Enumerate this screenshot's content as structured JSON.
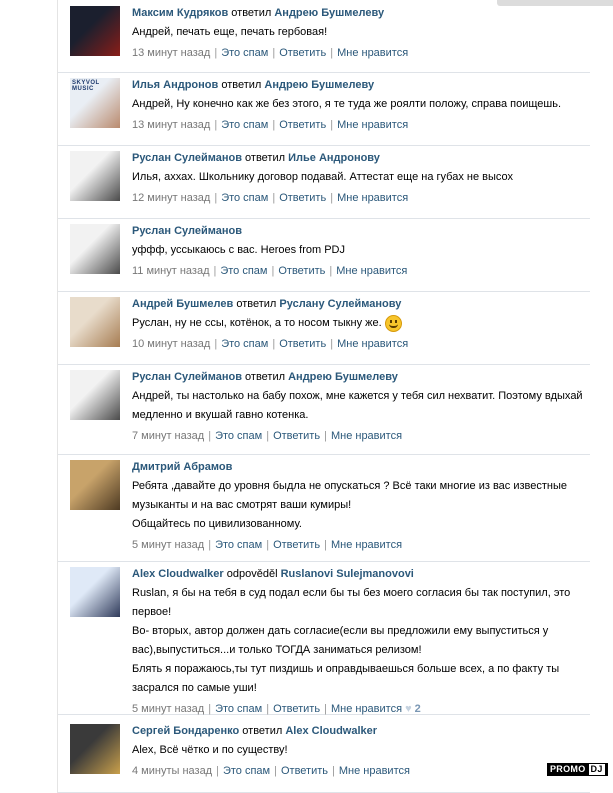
{
  "comments": [
    {
      "author": "Максим Кудряков",
      "verb": "ответил",
      "target": "Андрею Бушмелеву",
      "lines": [
        "Андрей, печать еще, печать гербовая!"
      ],
      "time": "13 минут назад",
      "spam": "Это спам",
      "reply": "Ответить",
      "like": "Мне нравится",
      "avatar_colors": [
        "#1b1f2e",
        "#8a1e18"
      ]
    },
    {
      "author": "Илья Андронов",
      "verb": "ответил",
      "target": "Андрею Бушмелеву",
      "lines": [
        "Андрей, Ну конечно как же без этого, я те туда же роялти положу, справа поищешь."
      ],
      "time": "13 минут назад",
      "spam": "Это спам",
      "reply": "Ответить",
      "like": "Мне нравится",
      "avatar_text": "SKYVOL MUSIC",
      "avatar_colors": [
        "#e9eef4",
        "#b98a6e"
      ]
    },
    {
      "author": "Руслан Сулейманов",
      "verb": "ответил",
      "target": "Илье Андронову",
      "lines": [
        "Илья, аххах. Школьнику договор подавай. Аттестат еще на губах не высох"
      ],
      "time": "12 минут назад",
      "spam": "Это спам",
      "reply": "Ответить",
      "like": "Мне нравится",
      "avatar_colors": [
        "#f2f2f2",
        "#4a4a4a"
      ]
    },
    {
      "author": "Руслан Сулейманов",
      "verb": "",
      "target": "",
      "lines": [
        "уффф, уссыкаюсь с вас. Heroes from PDJ"
      ],
      "time": "11 минут назад",
      "spam": "Это спам",
      "reply": "Ответить",
      "like": "Мне нравится",
      "avatar_colors": [
        "#f2f2f2",
        "#4a4a4a"
      ]
    },
    {
      "author": "Андрей Бушмелев",
      "verb": "ответил",
      "target": "Руслану Сулейманову",
      "lines": [
        "Руслан, ну не ссы, котёнок, а то носом тыкну же."
      ],
      "smiley": true,
      "time": "10 минут назад",
      "spam": "Это спам",
      "reply": "Ответить",
      "like": "Мне нравится",
      "avatar_colors": [
        "#e8dccb",
        "#a67c52"
      ]
    },
    {
      "author": "Руслан Сулейманов",
      "verb": "ответил",
      "target": "Андрею Бушмелеву",
      "lines": [
        "Андрей, ты настолько на бабу похож, мне кажется у тебя сил нехватит. Поэтому вдыхай",
        "медленно и вкушай гавно котенка."
      ],
      "time": "7 минут назад",
      "spam": "Это спам",
      "reply": "Ответить",
      "like": "Мне нравится",
      "avatar_colors": [
        "#f2f2f2",
        "#4a4a4a"
      ]
    },
    {
      "author": "Дмитрий Абрамов",
      "verb": "",
      "target": "",
      "lines": [
        "Ребята ,давайте до уровня быдла не опускаться ? Всё таки многие из вас известные",
        "музыканты и на вас смотрят ваши кумиры!",
        "Общайтесь по цивилизованному."
      ],
      "time": "5 минут назад",
      "spam": "Это спам",
      "reply": "Ответить",
      "like": "Мне нравится",
      "avatar_colors": [
        "#c8a36a",
        "#4e3a22"
      ]
    },
    {
      "author": "Alex Cloudwalker",
      "verb": "odpověděl",
      "target": "Ruslanovi Sulejmanovovi",
      "lines": [
        "Ruslan, я бы на тебя в суд подал если бы ты без моего согласия бы так поступил, это",
        "первое!",
        "Во- вторых, автор должен дать согласие(если вы предложили ему выпуститься у",
        "вас),выпуститься...и только ТОГДА заниматься релизом!",
        "Блять я поражаюсь,ты тут пиздишь и оправдываешься больше всех, а по факту ты",
        "засрался по самые уши!"
      ],
      "time": "5 минут назад",
      "spam": "Это спам",
      "reply": "Ответить",
      "like": "Мне нравится",
      "likes_count": "2",
      "avatar_colors": [
        "#dfe9f7",
        "#2f3a5a"
      ]
    },
    {
      "author": "Сергей Бондаренко",
      "verb": "ответил",
      "target": "Alex Cloudwalker",
      "lines": [
        "Alex, Всё чётко и по существу!"
      ],
      "time": "4 минуты назад",
      "spam": "Это спам",
      "reply": "Ответить",
      "like": "Мне нравится",
      "avatar_colors": [
        "#3a3a3a",
        "#c9a04b"
      ]
    }
  ],
  "watermark": {
    "promo": "PROMO",
    "dj": "DJ"
  }
}
